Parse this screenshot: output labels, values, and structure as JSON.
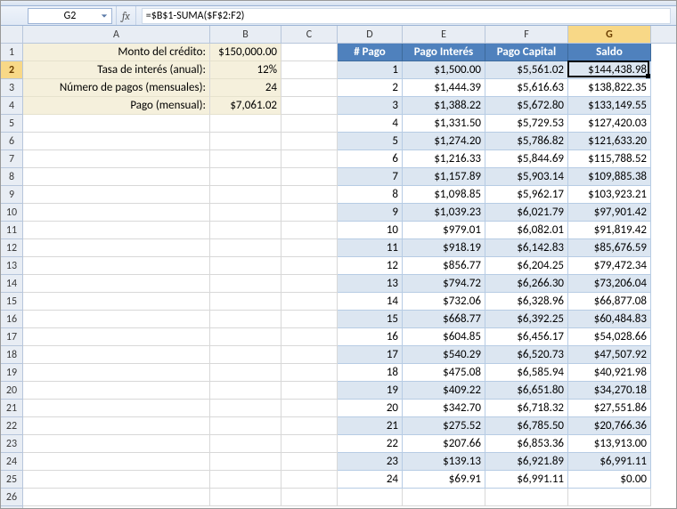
{
  "name_box": "G2",
  "fx_prefix": "fx",
  "formula": "=$B$1-SUMA($F$2:F2)",
  "col_letters": [
    "A",
    "B",
    "C",
    "D",
    "E",
    "F",
    "G"
  ],
  "row_numbers": [
    1,
    2,
    3,
    4,
    5,
    6,
    7,
    8,
    9,
    10,
    11,
    12,
    13,
    14,
    15,
    16,
    17,
    18,
    19,
    20,
    21,
    22,
    23,
    24,
    25,
    26
  ],
  "active_col_index": 6,
  "active_row_index": 1,
  "left_block": {
    "rows": [
      {
        "label": "Monto del crédito:",
        "value": "$150,000.00"
      },
      {
        "label": "Tasa de interés (anual):",
        "value": "12%"
      },
      {
        "label": "Número de pagos (mensuales):",
        "value": "24"
      },
      {
        "label": "Pago (mensual):",
        "value": "$7,061.02"
      }
    ]
  },
  "table": {
    "headers": [
      "# Pago",
      "Pago Interés",
      "Pago Capital",
      "Saldo"
    ],
    "rows": [
      {
        "n": 1,
        "i": "$1,500.00",
        "c": "$5,561.02",
        "s": "$144,438.98"
      },
      {
        "n": 2,
        "i": "$1,444.39",
        "c": "$5,616.63",
        "s": "$138,822.35"
      },
      {
        "n": 3,
        "i": "$1,388.22",
        "c": "$5,672.80",
        "s": "$133,149.55"
      },
      {
        "n": 4,
        "i": "$1,331.50",
        "c": "$5,729.53",
        "s": "$127,420.03"
      },
      {
        "n": 5,
        "i": "$1,274.20",
        "c": "$5,786.82",
        "s": "$121,633.20"
      },
      {
        "n": 6,
        "i": "$1,216.33",
        "c": "$5,844.69",
        "s": "$115,788.52"
      },
      {
        "n": 7,
        "i": "$1,157.89",
        "c": "$5,903.14",
        "s": "$109,885.38"
      },
      {
        "n": 8,
        "i": "$1,098.85",
        "c": "$5,962.17",
        "s": "$103,923.21"
      },
      {
        "n": 9,
        "i": "$1,039.23",
        "c": "$6,021.79",
        "s": "$97,901.42"
      },
      {
        "n": 10,
        "i": "$979.01",
        "c": "$6,082.01",
        "s": "$91,819.42"
      },
      {
        "n": 11,
        "i": "$918.19",
        "c": "$6,142.83",
        "s": "$85,676.59"
      },
      {
        "n": 12,
        "i": "$856.77",
        "c": "$6,204.25",
        "s": "$79,472.34"
      },
      {
        "n": 13,
        "i": "$794.72",
        "c": "$6,266.30",
        "s": "$73,206.04"
      },
      {
        "n": 14,
        "i": "$732.06",
        "c": "$6,328.96",
        "s": "$66,877.08"
      },
      {
        "n": 15,
        "i": "$668.77",
        "c": "$6,392.25",
        "s": "$60,484.83"
      },
      {
        "n": 16,
        "i": "$604.85",
        "c": "$6,456.17",
        "s": "$54,028.66"
      },
      {
        "n": 17,
        "i": "$540.29",
        "c": "$6,520.73",
        "s": "$47,507.92"
      },
      {
        "n": 18,
        "i": "$475.08",
        "c": "$6,585.94",
        "s": "$40,921.98"
      },
      {
        "n": 19,
        "i": "$409.22",
        "c": "$6,651.80",
        "s": "$34,270.18"
      },
      {
        "n": 20,
        "i": "$342.70",
        "c": "$6,718.32",
        "s": "$27,551.86"
      },
      {
        "n": 21,
        "i": "$275.52",
        "c": "$6,785.50",
        "s": "$20,766.36"
      },
      {
        "n": 22,
        "i": "$207.66",
        "c": "$6,853.36",
        "s": "$13,913.00"
      },
      {
        "n": 23,
        "i": "$139.13",
        "c": "$6,921.89",
        "s": "$6,991.11"
      },
      {
        "n": 24,
        "i": "$69.91",
        "c": "$6,991.11",
        "s": "$0.00"
      }
    ]
  },
  "chart_data": {
    "type": "table",
    "title": "Amortization schedule",
    "columns": [
      "# Pago",
      "Pago Interés",
      "Pago Capital",
      "Saldo"
    ],
    "x": [
      1,
      2,
      3,
      4,
      5,
      6,
      7,
      8,
      9,
      10,
      11,
      12,
      13,
      14,
      15,
      16,
      17,
      18,
      19,
      20,
      21,
      22,
      23,
      24
    ],
    "series": [
      {
        "name": "Pago Interés",
        "values": [
          1500.0,
          1444.39,
          1388.22,
          1331.5,
          1274.2,
          1216.33,
          1157.89,
          1098.85,
          1039.23,
          979.01,
          918.19,
          856.77,
          794.72,
          732.06,
          668.77,
          604.85,
          540.29,
          475.08,
          409.22,
          342.7,
          275.52,
          207.66,
          139.13,
          69.91
        ]
      },
      {
        "name": "Pago Capital",
        "values": [
          5561.02,
          5616.63,
          5672.8,
          5729.53,
          5786.82,
          5844.69,
          5903.14,
          5962.17,
          6021.79,
          6082.01,
          6142.83,
          6204.25,
          6266.3,
          6328.96,
          6392.25,
          6456.17,
          6520.73,
          6585.94,
          6651.8,
          6718.32,
          6785.5,
          6853.36,
          6921.89,
          6991.11
        ]
      },
      {
        "name": "Saldo",
        "values": [
          144438.98,
          138822.35,
          133149.55,
          127420.03,
          121633.2,
          115788.52,
          109885.38,
          103923.21,
          97901.42,
          91819.42,
          85676.59,
          79472.34,
          73206.04,
          66877.08,
          60484.83,
          54028.66,
          47507.92,
          40921.98,
          34270.18,
          27551.86,
          20766.36,
          13913.0,
          6991.11,
          0.0
        ]
      }
    ]
  },
  "colors": {
    "header_blue": "#4f81bd",
    "band_light": "#dce6f1",
    "yellow_header": "#f5f0dc",
    "active_header": "#f8d887"
  }
}
